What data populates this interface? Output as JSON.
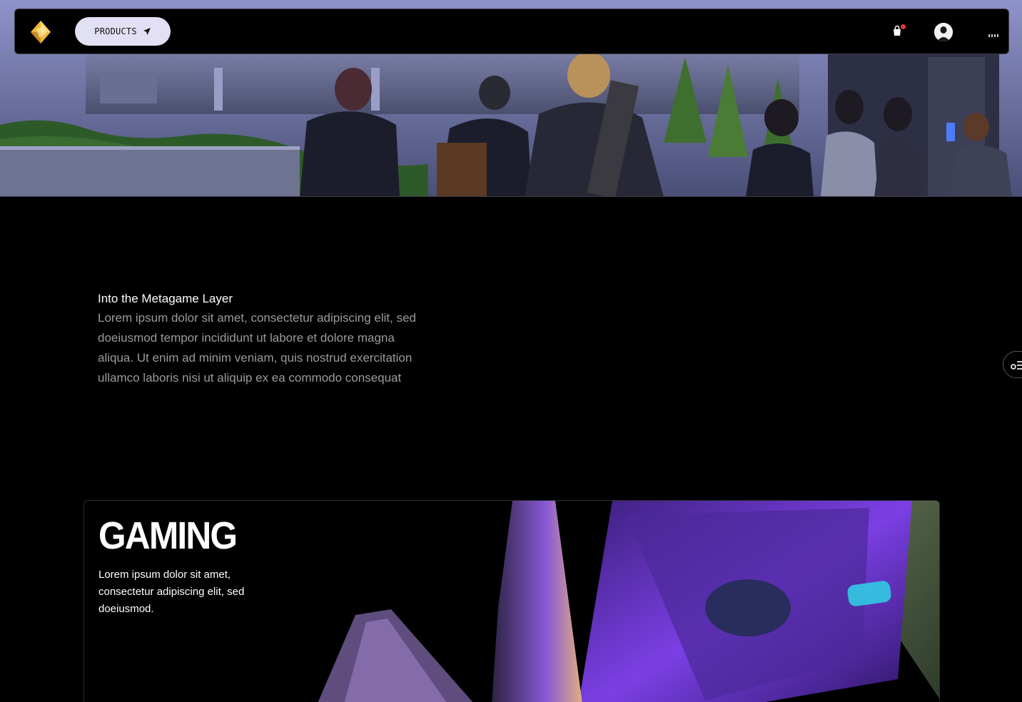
{
  "nav": {
    "logo_icon": "diamond-logo-icon",
    "products_label": "PRODUCTS",
    "products_icon": "paper-plane-icon",
    "cart_icon": "shopping-bag-icon",
    "avatar_icon": "user-avatar",
    "more_icon": "dots-menu-icon"
  },
  "intro": {
    "title": "Into the Metagame Layer",
    "body": "Lorem ipsum dolor sit amet, consectetur adipiscing elit, sed doeiusmod tempor incididunt ut labore et dolore magna aliqua. Ut enim ad minim veniam, quis nostrud exercitation ullamco laboris nisi ut aliquip ex ea commodo consequat"
  },
  "side_tab": {
    "icon": "filter-settings-icon"
  },
  "gaming": {
    "title": "GAMING",
    "description": "Lorem ipsum dolor sit amet, consectetur adipiscing elit, sed doeiusmod."
  },
  "colors": {
    "background": "#000000",
    "products_button": "#e2e0f4",
    "notification_dot": "#e23b3b",
    "intro_body_text": "#9b9b9b",
    "accent_purple": "#7b3fe4"
  }
}
